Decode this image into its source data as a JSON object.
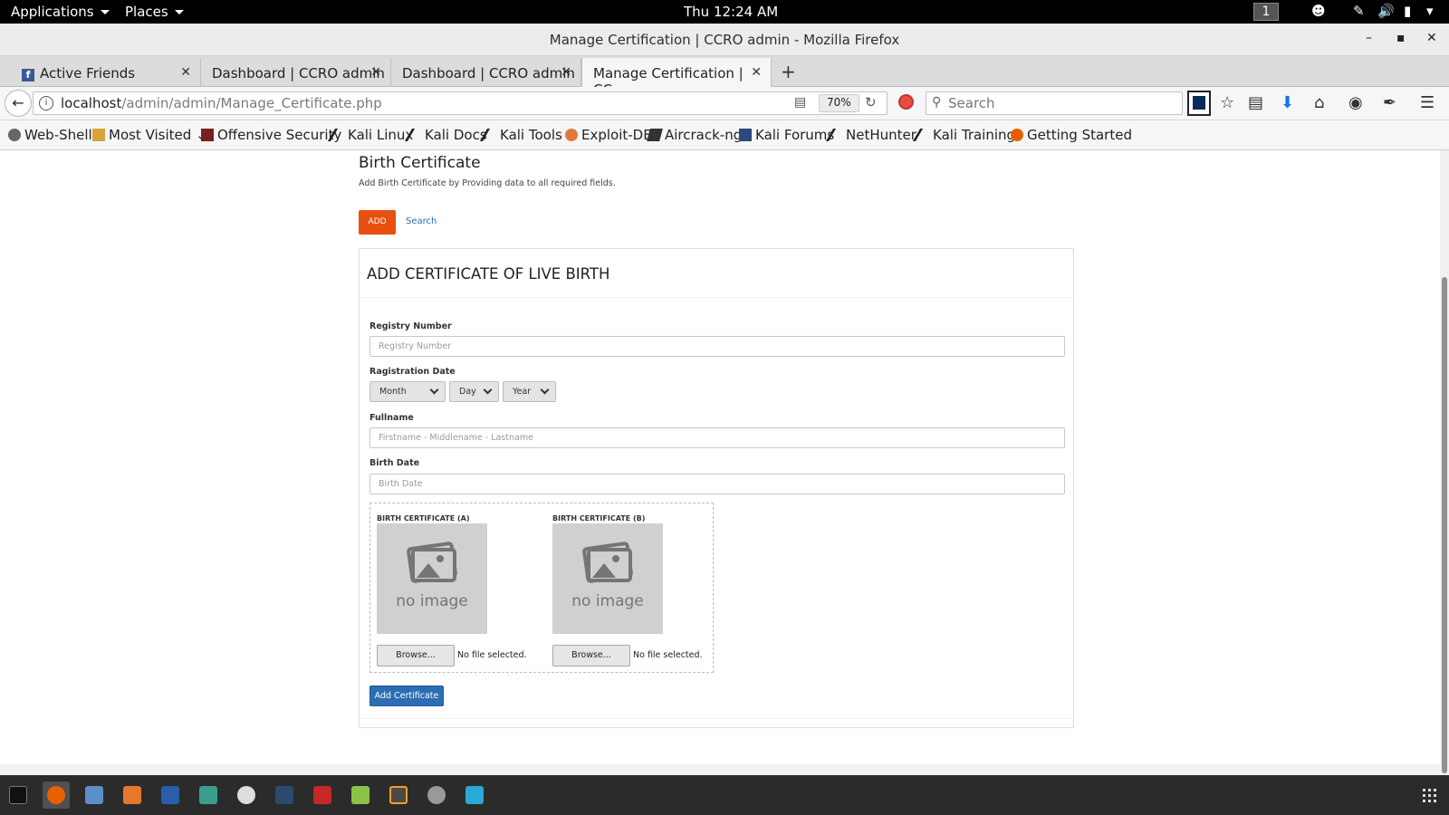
{
  "system_bar": {
    "applications": "Applications",
    "places": "Places",
    "clock": "Thu 12:24 AM",
    "workspace": "1"
  },
  "window": {
    "title": "Manage Certification | CCRO admin - Mozilla Firefox"
  },
  "tabs": [
    {
      "label": "Active Friends"
    },
    {
      "label": "Dashboard | CCRO admin"
    },
    {
      "label": "Dashboard | CCRO admin"
    },
    {
      "label": "Manage Certification | CC..."
    }
  ],
  "navbar": {
    "url_host": "localhost",
    "url_path": "/admin/admin/Manage_Certificate.php",
    "zoom": "70%",
    "search_placeholder": "Search"
  },
  "bookmarks": [
    {
      "label": "Web-Shell",
      "icon": "globe-icon"
    },
    {
      "label": "Most Visited",
      "icon": "folder-icon"
    },
    {
      "label": "Offensive Security",
      "icon": "offsec-icon"
    },
    {
      "label": "Kali Linux",
      "icon": "kali-icon"
    },
    {
      "label": "Kali Docs",
      "icon": "kali-icon"
    },
    {
      "label": "Kali Tools",
      "icon": "kali-icon"
    },
    {
      "label": "Exploit-DB",
      "icon": "exploit-icon"
    },
    {
      "label": "Aircrack-ng",
      "icon": "aircrack-icon"
    },
    {
      "label": "Kali Forums",
      "icon": "forums-icon"
    },
    {
      "label": "NetHunter",
      "icon": "kali-icon"
    },
    {
      "label": "Kali Training",
      "icon": "kali-icon"
    },
    {
      "label": "Getting Started",
      "icon": "firefox-icon"
    }
  ],
  "page": {
    "heading": "Birth Certificate",
    "subheading": "Add Birth Certificate by Providing data to all required fields.",
    "add_button": "ADD",
    "search_link": "Search",
    "panel_title": "ADD CERTIFICATE OF LIVE BIRTH",
    "registry_label": "Registry Number",
    "registry_placeholder": "Registry Number",
    "reg_date_label": "Ragistration Date",
    "month": "Month",
    "day": "Day",
    "year": "Year",
    "fullname_label": "Fullname",
    "fullname_placeholder": "Firstname - Middlename - Lastname",
    "birthdate_label": "Birth Date",
    "birthdate_placeholder": "Birth Date",
    "cert_a_label": "BIRTH CERTIFICATE (A)",
    "cert_b_label": "BIRTH CERTIFICATE (B)",
    "no_image": "no image",
    "browse": "Browse...",
    "no_file": "No file selected.",
    "submit": "Add Certificate"
  },
  "colors": {
    "add_button": "#e8500f",
    "submit_button": "#2c6db3",
    "link": "#2a6fb0"
  }
}
